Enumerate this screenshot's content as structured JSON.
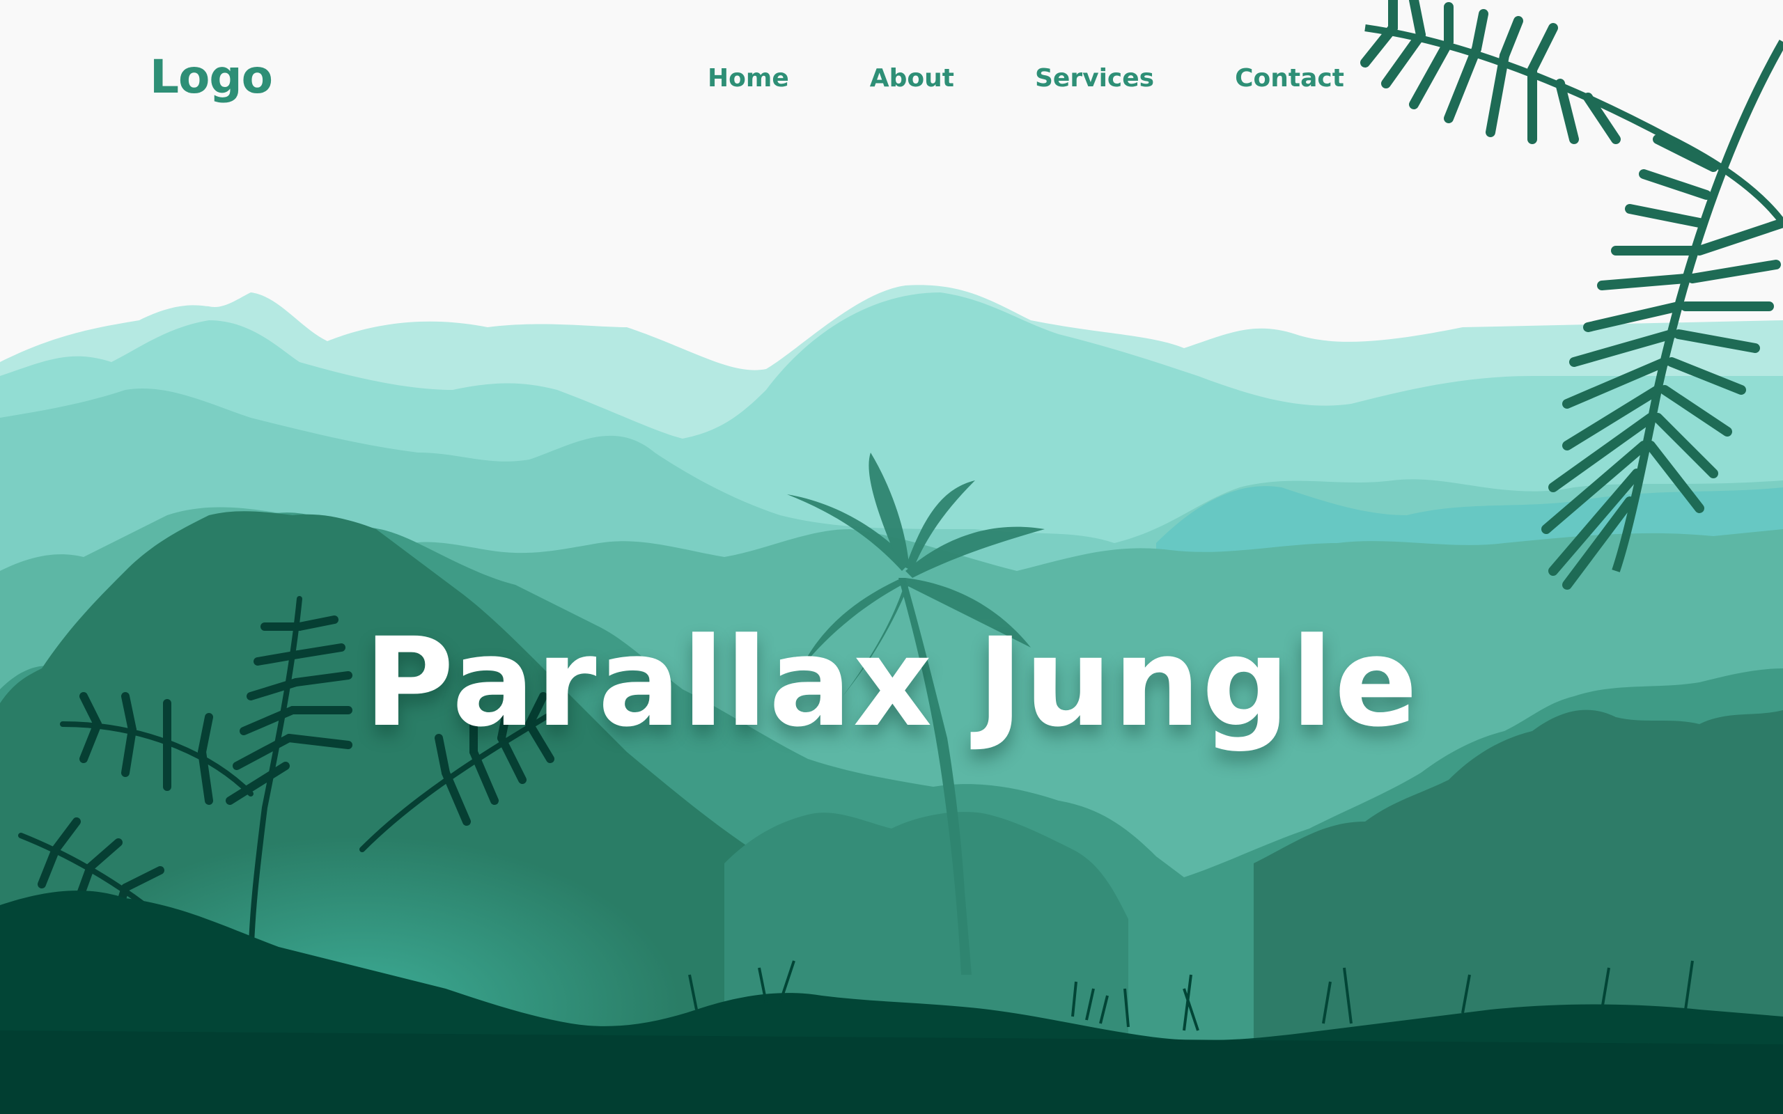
{
  "header": {
    "logo": "Logo",
    "nav": [
      "Home",
      "About",
      "Services",
      "Contact"
    ]
  },
  "hero": {
    "title": "Parallax Jungle"
  },
  "colors": {
    "background": "#f9f9f9",
    "brand": "#2e8f76",
    "mountain_far": "#b5e9e2",
    "mountain_mid": "#92ddd3",
    "jungle_mid": "#4fac99",
    "jungle_dark": "#2a7d66",
    "foreground": "#013e31",
    "title": "#ffffff"
  }
}
